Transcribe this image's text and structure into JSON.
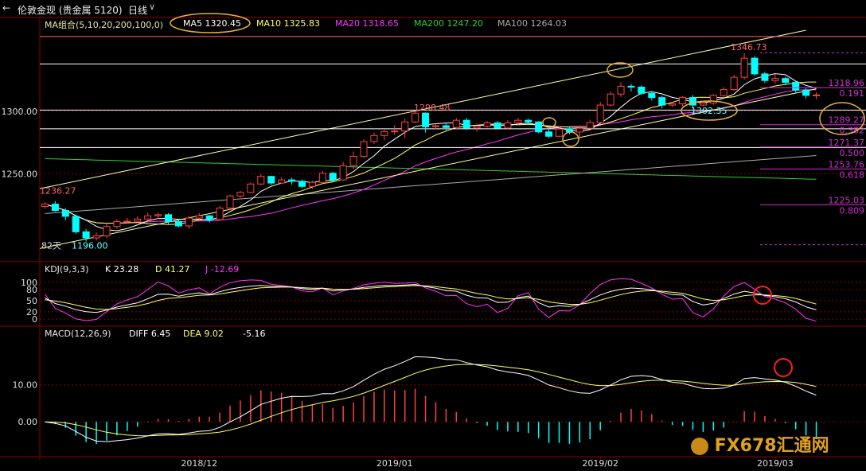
{
  "header": {
    "back_icon": "back-arrow-icon",
    "instrument": "伦敦金现 (贵金属 5120)",
    "period": "日线",
    "period_dropdown_icon": "chevron-down-icon"
  },
  "ma_legend": {
    "group": "MA组合(5,10,20,200,100,0)",
    "ma5": "MA5 1320.45",
    "ma10": "MA10 1325.83",
    "ma20": "MA20 1318.65",
    "ma200": "MA200 1247.20",
    "ma100": "MA100 1264.03"
  },
  "kdj_legend": {
    "title": "KDJ(9,3,3)",
    "k": "K 23.28",
    "d": "D 41.27",
    "j": "J -12.69"
  },
  "macd_legend": {
    "title": "MACD(12,26,9)",
    "diff": "DIFF 6.45",
    "dea": "DEA 9.02",
    "macd": "-5.16"
  },
  "colors": {
    "up": "#ff4040",
    "down": "#00ffff",
    "ma5": "#ffffff",
    "ma10": "#ffff66",
    "ma20": "#ff33ff",
    "ma200": "#33cc33",
    "ma100": "#aaaaaa",
    "fib": "#cc33cc",
    "annot": "#e8b23a",
    "marker": "#ff2020"
  },
  "watermark": {
    "brand": "FX678",
    "suffix": "汇通网"
  },
  "chart_data": [
    {
      "type": "candlestick",
      "panel": "price",
      "y_ticks": [
        1300,
        1250
      ],
      "y_tick_labels": [
        "1300.00",
        "1250.00"
      ],
      "ylim": [
        1180,
        1365
      ],
      "x_tick_labels": [
        "2018/12",
        "2019/01",
        "2019/02",
        "2019/03"
      ],
      "x_tick_index": [
        15,
        34,
        54,
        71
      ],
      "candles": [
        [
          1223.7,
          1225.6,
          1221.8,
          1227.0
        ],
        [
          1225.6,
          1220.5,
          1219.5,
          1227.9
        ],
        [
          1220.5,
          1215.8,
          1212.6,
          1222.4
        ],
        [
          1215.8,
          1203.4,
          1201.7,
          1217.3
        ],
        [
          1203.4,
          1198.5,
          1195.6,
          1205.7
        ],
        [
          1198.5,
          1200.1,
          1196.5,
          1202.9
        ],
        [
          1200.1,
          1207.6,
          1198.5,
          1210.7
        ],
        [
          1207.6,
          1211.6,
          1205.9,
          1213.4
        ],
        [
          1211.6,
          1211.9,
          1210.5,
          1214.6
        ],
        [
          1211.9,
          1213.6,
          1211.0,
          1215.8
        ],
        [
          1213.6,
          1216.2,
          1212.8,
          1218.8
        ],
        [
          1216.2,
          1217.1,
          1213.8,
          1218.9
        ],
        [
          1217.1,
          1211.6,
          1209.5,
          1218.4
        ],
        [
          1211.6,
          1208.1,
          1206.9,
          1212.9
        ],
        [
          1208.1,
          1214.4,
          1205.6,
          1216.3
        ],
        [
          1214.4,
          1216.2,
          1212.9,
          1218.4
        ],
        [
          1216.2,
          1213.1,
          1210.9,
          1216.9
        ],
        [
          1213.1,
          1222.4,
          1212.3,
          1224.2
        ],
        [
          1222.4,
          1232.1,
          1220.5,
          1233.2
        ],
        [
          1232.1,
          1235.0,
          1230.5,
          1236.3
        ],
        [
          1235.0,
          1241.7,
          1234.2,
          1242.8
        ],
        [
          1241.7,
          1247.8,
          1240.8,
          1249.7
        ],
        [
          1247.8,
          1242.5,
          1240.9,
          1248.3
        ],
        [
          1242.5,
          1245.0,
          1241.6,
          1247.2
        ],
        [
          1245.0,
          1243.9,
          1241.2,
          1246.8
        ],
        [
          1243.9,
          1239.8,
          1238.2,
          1245.2
        ],
        [
          1239.8,
          1243.0,
          1237.7,
          1244.3
        ],
        [
          1243.0,
          1250.3,
          1241.5,
          1252.1
        ],
        [
          1250.3,
          1245.0,
          1243.8,
          1251.5
        ],
        [
          1245.0,
          1256.3,
          1244.3,
          1259.4
        ],
        [
          1256.3,
          1263.9,
          1253.5,
          1267.8
        ],
        [
          1263.9,
          1275.7,
          1262.7,
          1277.6
        ],
        [
          1275.7,
          1280.6,
          1273.9,
          1283.0
        ],
        [
          1280.6,
          1283.8,
          1276.6,
          1285.2
        ],
        [
          1283.8,
          1284.2,
          1281.4,
          1288.9
        ],
        [
          1284.2,
          1291.5,
          1278.6,
          1294.1
        ],
        [
          1291.5,
          1298.5,
          1290.4,
          1300.0
        ],
        [
          1298.5,
          1287.6,
          1283.0,
          1299.1
        ],
        [
          1287.6,
          1288.4,
          1285.4,
          1290.1
        ],
        [
          1288.4,
          1287.0,
          1284.6,
          1290.4
        ],
        [
          1287.0,
          1292.8,
          1285.4,
          1294.5
        ],
        [
          1292.8,
          1286.6,
          1285.2,
          1294.7
        ],
        [
          1286.6,
          1288.0,
          1283.5,
          1290.2
        ],
        [
          1288.0,
          1290.7,
          1286.8,
          1292.3
        ],
        [
          1290.7,
          1286.6,
          1285.4,
          1292.3
        ],
        [
          1286.6,
          1290.7,
          1285.5,
          1292.8
        ],
        [
          1290.7,
          1292.8,
          1289.1,
          1294.6
        ],
        [
          1292.8,
          1291.5,
          1288.8,
          1294.0
        ],
        [
          1291.5,
          1283.5,
          1282.4,
          1292.1
        ],
        [
          1283.5,
          1280.0,
          1278.7,
          1286.4
        ],
        [
          1280.0,
          1285.8,
          1279.3,
          1288.0
        ],
        [
          1285.8,
          1283.4,
          1281.5,
          1287.7
        ],
        [
          1283.4,
          1286.4,
          1277.8,
          1288.7
        ],
        [
          1286.4,
          1291.0,
          1285.7,
          1293.3
        ],
        [
          1291.0,
          1305.0,
          1290.4,
          1307.5
        ],
        [
          1305.0,
          1313.8,
          1303.6,
          1316.0
        ],
        [
          1313.8,
          1320.1,
          1311.4,
          1323.3
        ],
        [
          1320.1,
          1319.4,
          1315.9,
          1322.1
        ],
        [
          1319.4,
          1314.4,
          1313.0,
          1320.7
        ],
        [
          1314.4,
          1311.0,
          1308.6,
          1316.1
        ],
        [
          1311.0,
          1305.0,
          1302.4,
          1312.5
        ],
        [
          1305.0,
          1306.0,
          1303.6,
          1307.6
        ],
        [
          1306.0,
          1311.0,
          1304.2,
          1312.2
        ],
        [
          1311.0,
          1305.0,
          1302.4,
          1313.0
        ],
        [
          1305.0,
          1306.6,
          1304.0,
          1307.7
        ],
        [
          1306.6,
          1312.7,
          1305.2,
          1313.8
        ],
        [
          1312.7,
          1317.4,
          1311.6,
          1319.3
        ],
        [
          1317.4,
          1327.3,
          1316.6,
          1329.3
        ],
        [
          1327.3,
          1342.6,
          1325.4,
          1346.7
        ],
        [
          1342.6,
          1330.0,
          1328.4,
          1344.2
        ],
        [
          1330.0,
          1324.7,
          1322.6,
          1331.6
        ],
        [
          1324.7,
          1326.3,
          1322.4,
          1329.7
        ],
        [
          1326.3,
          1323.2,
          1320.9,
          1327.7
        ],
        [
          1323.2,
          1317.0,
          1315.2,
          1324.7
        ],
        [
          1317.0,
          1312.8,
          1310.4,
          1318.5
        ],
        [
          1312.8,
          1313.1,
          1309.7,
          1315.2
        ]
      ],
      "annotations": [
        "1236.27",
        "1196.00",
        "1298.48",
        "1346.73",
        "1302.35"
      ],
      "days_label": "82天",
      "fib_levels": [
        {
          "price": 1318.96,
          "label": "1318.96",
          "ratio": "0.191"
        },
        {
          "price": 1289.27,
          "label": "1289.27",
          "ratio": "0.382"
        },
        {
          "price": 1271.37,
          "label": "1271.37",
          "ratio": "0.500"
        },
        {
          "price": 1253.76,
          "label": "1253.76",
          "ratio": "0.618"
        },
        {
          "price": 1225.03,
          "label": "1225.03",
          "ratio": "0.809"
        }
      ]
    },
    {
      "type": "line",
      "panel": "kdj",
      "y_tick_labels": [
        "100",
        "80",
        "50",
        "20",
        "0"
      ],
      "y_ticks": [
        100,
        80,
        50,
        20,
        0
      ],
      "ylim": [
        -15,
        115
      ]
    },
    {
      "type": "line+bar",
      "panel": "macd",
      "y_tick_labels": [
        "10.00",
        "0.00"
      ],
      "y_ticks": [
        10,
        0
      ],
      "ylim": [
        -9,
        22
      ]
    }
  ]
}
